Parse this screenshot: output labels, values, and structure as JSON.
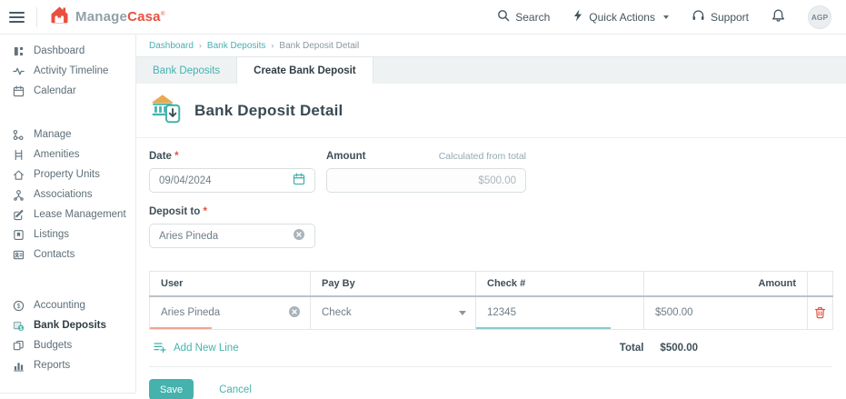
{
  "header": {
    "logo": {
      "brand_first": "Manage",
      "brand_second": "Casa",
      "registered_mark": "®"
    },
    "actions": {
      "search_label": "Search",
      "quick_actions_label": "Quick Actions",
      "support_label": "Support",
      "avatar_initials": "AGP"
    }
  },
  "sidebar": {
    "groups": [
      {
        "items": [
          {
            "label": "Dashboard"
          },
          {
            "label": "Activity Timeline"
          },
          {
            "label": "Calendar"
          }
        ]
      },
      {
        "items": [
          {
            "label": "Manage"
          },
          {
            "label": "Amenities"
          },
          {
            "label": "Property Units"
          },
          {
            "label": "Associations"
          },
          {
            "label": "Lease Management"
          },
          {
            "label": "Listings"
          },
          {
            "label": "Contacts"
          }
        ]
      },
      {
        "items": [
          {
            "label": "Accounting"
          },
          {
            "label": "Bank Deposits",
            "active": true
          },
          {
            "label": "Budgets"
          },
          {
            "label": "Reports"
          }
        ]
      }
    ]
  },
  "breadcrumb": {
    "separator": "›",
    "items": [
      "Dashboard",
      "Bank Deposits",
      "Bank Deposit Detail"
    ]
  },
  "tabs": [
    {
      "label": "Bank Deposits",
      "active": false
    },
    {
      "label": "Create Bank Deposit",
      "active": true
    }
  ],
  "page": {
    "title": "Bank Deposit Detail"
  },
  "form": {
    "date": {
      "label": "Date",
      "required_mark": "*",
      "value": "09/04/2024"
    },
    "amount": {
      "label": "Amount",
      "hint": "Calculated from total",
      "value": "$500.00"
    },
    "deposit_to": {
      "label": "Deposit to",
      "required_mark": "*",
      "value": "Aries Pineda"
    }
  },
  "table": {
    "columns": [
      "User",
      "Pay By",
      "Check #",
      "Amount"
    ],
    "rows": [
      {
        "user": "Aries Pineda",
        "pay_by": "Check",
        "check_no": "12345",
        "amount": "$500.00"
      }
    ],
    "add_new_line_label": "Add New Line",
    "total_label": "Total",
    "total_value": "$500.00"
  },
  "footer": {
    "save_label": "Save",
    "cancel_label": "Cancel"
  },
  "colors": {
    "teal": "#45b2ae",
    "coral": "#e8503f",
    "salmon_underline": "#f2a493",
    "teal_underline": "#86ccce"
  }
}
